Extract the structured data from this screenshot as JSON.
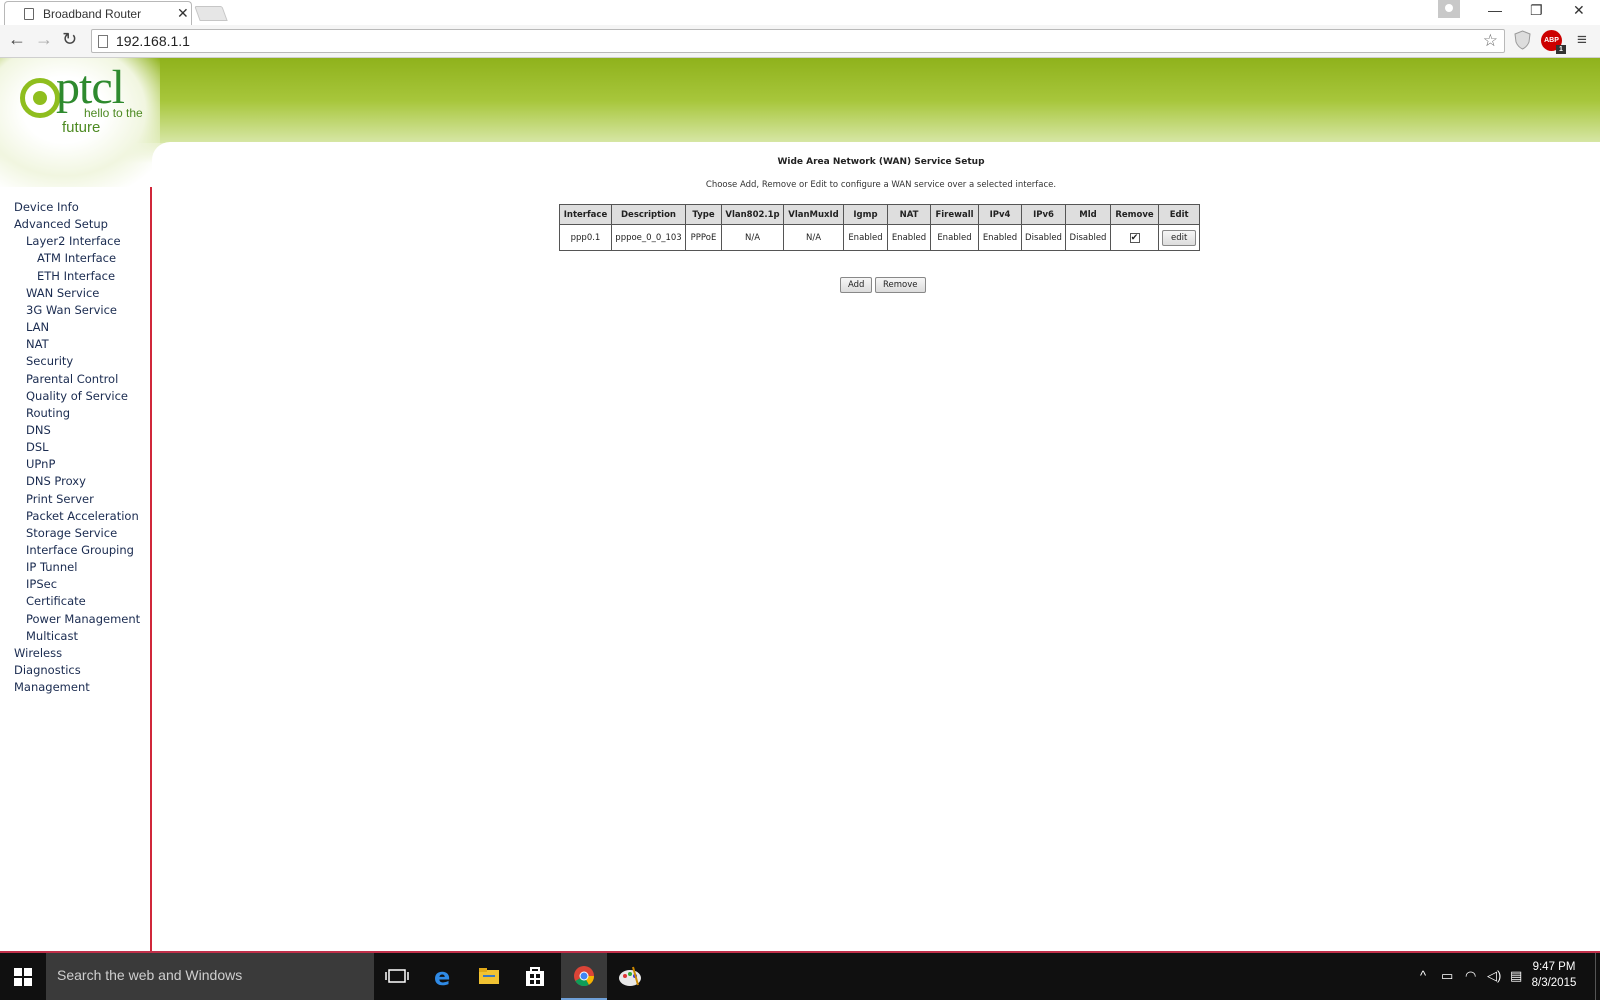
{
  "browser": {
    "tab_title": "Broadband Router",
    "tab_close": "✕",
    "address": "192.168.1.1",
    "abp_label": "ABP",
    "abp_count": "1"
  },
  "logo": {
    "brand": "ptcl",
    "tagline_1": "hello to the",
    "tagline_2": "future"
  },
  "sidebar": {
    "items": [
      {
        "label": "Device Info",
        "level": 0
      },
      {
        "label": "Advanced Setup",
        "level": 0
      },
      {
        "label": "Layer2 Interface",
        "level": 1
      },
      {
        "label": "ATM Interface",
        "level": 2
      },
      {
        "label": "ETH Interface",
        "level": 2
      },
      {
        "label": "WAN Service",
        "level": 1
      },
      {
        "label": "3G Wan Service",
        "level": 1
      },
      {
        "label": "LAN",
        "level": 1
      },
      {
        "label": "NAT",
        "level": 1
      },
      {
        "label": "Security",
        "level": 1
      },
      {
        "label": "Parental Control",
        "level": 1
      },
      {
        "label": "Quality of Service",
        "level": 1
      },
      {
        "label": "Routing",
        "level": 1
      },
      {
        "label": "DNS",
        "level": 1
      },
      {
        "label": "DSL",
        "level": 1
      },
      {
        "label": "UPnP",
        "level": 1
      },
      {
        "label": "DNS Proxy",
        "level": 1
      },
      {
        "label": "Print Server",
        "level": 1
      },
      {
        "label": "Packet Acceleration",
        "level": 1
      },
      {
        "label": "Storage Service",
        "level": 1
      },
      {
        "label": "Interface Grouping",
        "level": 1
      },
      {
        "label": "IP Tunnel",
        "level": 1
      },
      {
        "label": "IPSec",
        "level": 1
      },
      {
        "label": "Certificate",
        "level": 1
      },
      {
        "label": "Power Management",
        "level": 1
      },
      {
        "label": "Multicast",
        "level": 1
      },
      {
        "label": "Wireless",
        "level": 0
      },
      {
        "label": "Diagnostics",
        "level": 0
      },
      {
        "label": "Management",
        "level": 0
      }
    ]
  },
  "main": {
    "title": "Wide Area Network (WAN) Service Setup",
    "description": "Choose Add, Remove or Edit to configure a WAN service over a selected interface.",
    "table": {
      "headers": [
        "Interface",
        "Description",
        "Type",
        "Vlan802.1p",
        "VlanMuxId",
        "Igmp",
        "NAT",
        "Firewall",
        "IPv4",
        "IPv6",
        "Mld",
        "Remove",
        "Edit"
      ],
      "rows": [
        {
          "interface": "ppp0.1",
          "description": "pppoe_0_0_103",
          "type": "PPPoE",
          "vlan8021p": "N/A",
          "vlanmuxid": "N/A",
          "igmp": "Enabled",
          "nat": "Enabled",
          "firewall": "Enabled",
          "ipv4": "Enabled",
          "ipv6": "Disabled",
          "mld": "Disabled",
          "remove_checked": true,
          "edit_label": "edit"
        }
      ]
    },
    "add_label": "Add",
    "remove_label": "Remove"
  },
  "taskbar": {
    "search_placeholder": "Search the web and Windows",
    "time": "9:47 PM",
    "date": "8/3/2015"
  },
  "colors": {
    "banner_green": "#8fb21c",
    "sidebar_border": "#d0273a",
    "taskbar": "#101010"
  }
}
